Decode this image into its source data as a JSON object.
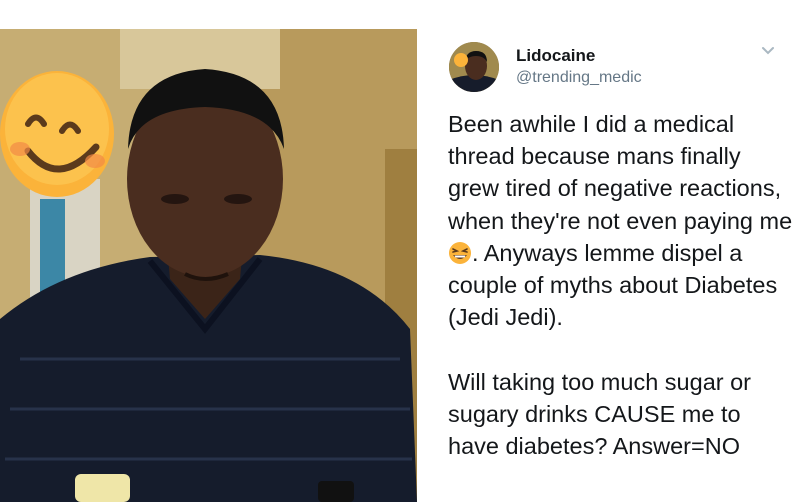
{
  "tweet": {
    "display_name": "Lidocaine",
    "handle": "@trending_medic",
    "text_part1": "Been awhile I did a medical thread because mans finally grew tired of negative reactions, when they're not even paying me ",
    "text_part2": ". Anyways lemme dispel a couple of myths about Diabetes (Jedi Jedi).\n\nWill taking too much sugar or sugary drinks CAUSE me to have diabetes? Answer=NO",
    "inline_emoji": "grinning-squinting-face",
    "menu_icon": "chevron-down-icon"
  },
  "photo": {
    "overlay_emoji": "smiling-face-with-smiling-eyes"
  },
  "colors": {
    "text": "#14171a",
    "secondary": "#657786",
    "emoji_yellow": "#fbb33a"
  }
}
